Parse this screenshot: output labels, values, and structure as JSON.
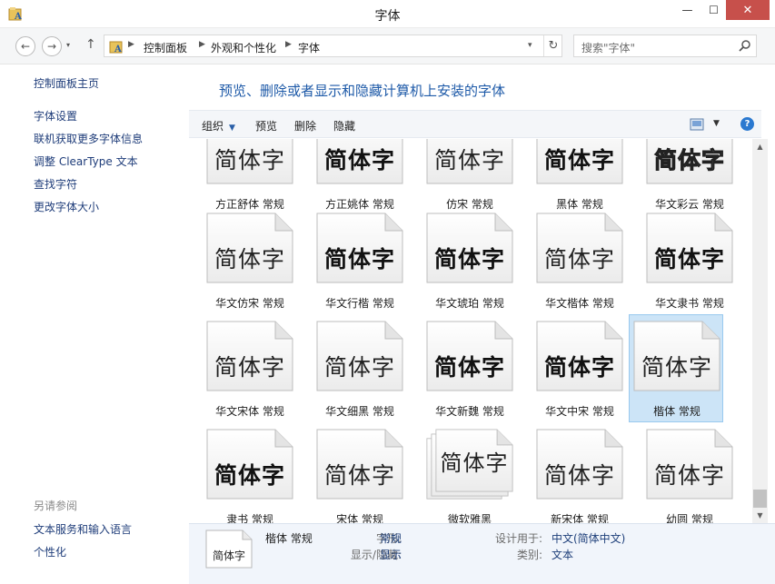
{
  "window": {
    "title": "字体",
    "minimize_glyph": "—",
    "maximize_glyph": "☐",
    "close_glyph": "✕"
  },
  "nav": {
    "back_glyph": "←",
    "forward_glyph": "→",
    "history_glyph": "▾",
    "up_glyph": "↑",
    "breadcrumbs": [
      "控制面板",
      "外观和个性化",
      "字体"
    ],
    "breadcrumb_sep": "▶",
    "dropdown_glyph": "▾",
    "refresh_glyph": "↻",
    "search_placeholder": "搜索\"字体\""
  },
  "sidebar": {
    "home": "控制面板主页",
    "links": [
      "字体设置",
      "联机获取更多字体信息",
      "调整 ClearType 文本",
      "查找字符",
      "更改字体大小"
    ],
    "see_also_title": "另请参阅",
    "see_also": [
      "文本服务和输入语言",
      "个性化"
    ]
  },
  "main": {
    "heading": "预览、删除或者显示和隐藏计算机上安装的字体"
  },
  "toolbar": {
    "organize": "组织",
    "organize_caret": "▼",
    "preview": "预览",
    "delete": "删除",
    "hide": "隐藏",
    "view_caret": "▼",
    "help": "?"
  },
  "fonts": [
    {
      "sample": "简体字",
      "name": "方正舒体 常规"
    },
    {
      "sample": "简体字",
      "name": "方正姚体 常规"
    },
    {
      "sample": "简体字",
      "name": "仿宋 常规"
    },
    {
      "sample": "简体字",
      "name": "黑体 常规"
    },
    {
      "sample": "简体字",
      "name": "华文彩云 常规"
    },
    {
      "sample": "简体字",
      "name": "华文仿宋 常规"
    },
    {
      "sample": "简体字",
      "name": "华文行楷 常规"
    },
    {
      "sample": "简体字",
      "name": "华文琥珀 常规"
    },
    {
      "sample": "简体字",
      "name": "华文楷体 常规"
    },
    {
      "sample": "简体字",
      "name": "华文隶书 常规"
    },
    {
      "sample": "简体字",
      "name": "华文宋体 常规"
    },
    {
      "sample": "简体字",
      "name": "华文细黑 常规"
    },
    {
      "sample": "简体字",
      "name": "华文新魏 常规"
    },
    {
      "sample": "简体字",
      "name": "华文中宋 常规"
    },
    {
      "sample": "简体字",
      "name": "楷体 常规",
      "selected": true
    },
    {
      "sample": "简体字",
      "name": "隶书 常规"
    },
    {
      "sample": "简体字",
      "name": "宋体 常规"
    },
    {
      "sample": "简体字",
      "name": "微软雅黑",
      "stacked": true
    },
    {
      "sample": "简体字",
      "name": "新宋体 常规"
    },
    {
      "sample": "简体字",
      "name": "幼圆 常规"
    }
  ],
  "scrollbar": {
    "up_glyph": "▲",
    "down_glyph": "▼"
  },
  "details": {
    "sample": "简体字",
    "name": "楷体 常规",
    "style_label": "字形:",
    "style_value": "常规",
    "visibility_label": "显示/隐藏:",
    "visibility_value": "显示",
    "designed_for_label": "设计用于:",
    "designed_for_value": "中文(简体中文)",
    "category_label": "类别:",
    "category_value": "文本"
  },
  "colors": {
    "accent": "#1e5aa8",
    "selection": "#cce4f7",
    "close_button": "#c7504b"
  }
}
